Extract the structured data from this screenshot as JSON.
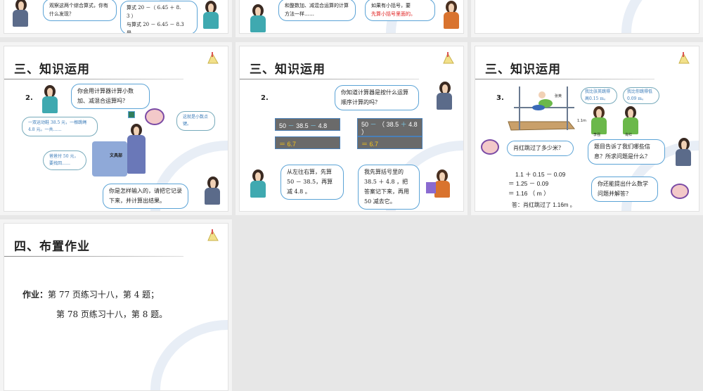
{
  "top_row": {
    "slide1": {
      "bubble_a": "观察这两个综合算式，你有什么发现？",
      "bubble_b_lines": [
        "算式 20 －（ 6.45 ＋ 8.",
        "3 ）",
        "与算式 20 － 6.45 － 8.3",
        "是"
      ]
    },
    "slide2": {
      "bubble_a": "和整数加、减混合运算的计算方法一样……",
      "bubble_b_plain": "如果有小括号，要",
      "bubble_b_red": "先算小括号里面的。"
    }
  },
  "slide_a": {
    "title": "三、知识运用",
    "number": "2.",
    "q1": "你会用计算器计算小数加、减混合运算吗？",
    "shoes": "一双运动鞋 38.5 元，一根跳绳 4.8 元。一共……",
    "key": "这就是小数点键。",
    "dad": "爸爸付 50 元，要找回……",
    "sign": "文具部",
    "q2": "你是怎样输入的，请把它记录下来，并计算出结果。"
  },
  "slide_b": {
    "title": "三、知识运用",
    "number": "2.",
    "q1": "你知道计算器是按什么运算顺序计算的吗？",
    "calc_left": {
      "a": "50",
      "op1": "－",
      "b": "38.5",
      "op2": "－",
      "c": "4.8",
      "result": "＝ 6.7"
    },
    "calc_right": {
      "a": "50",
      "op1": "－",
      "lp": "（",
      "b": "38.5",
      "op2": "＋",
      "c": "4.8",
      "rp": "）",
      "result": "＝ 6.7"
    },
    "left_bubble": "从左往右算，先算 50 － 38.5，再算减 4.8 。",
    "right_bubble": "我先算括号里的 38.5 ＋ 4.8 ，把答案记下来，再用 50 减去它。"
  },
  "slide_c": {
    "title": "三、知识运用",
    "number": "3.",
    "height_label": "1.1m",
    "name_zhang": "张英",
    "name_li": "李强",
    "name_xiao": "肖红",
    "li_bubble": "我比张英跳得高0.15 m。",
    "xiao_bubble": "我比你跳得低 0.09 m。",
    "q1": "肖红跳过了多少米？",
    "q2": "题目告诉了我们哪些信息？所求问题是什么？",
    "eq_lines": [
      "1.1 ＋ 0.15 － 0.09",
      "＝ 1.25 － 0.09",
      "＝ 1.16 （ m ）"
    ],
    "answer": "答：肖红跳过了 1.16m 。",
    "q3": "你还能提出什么数学问题并解答？"
  },
  "slide_d": {
    "title": "四、布置作业",
    "label": "作业：",
    "line1": "第 77 页练习十八，第 4 题；",
    "line2": "第 78 页练习十八，第 8 题。"
  }
}
